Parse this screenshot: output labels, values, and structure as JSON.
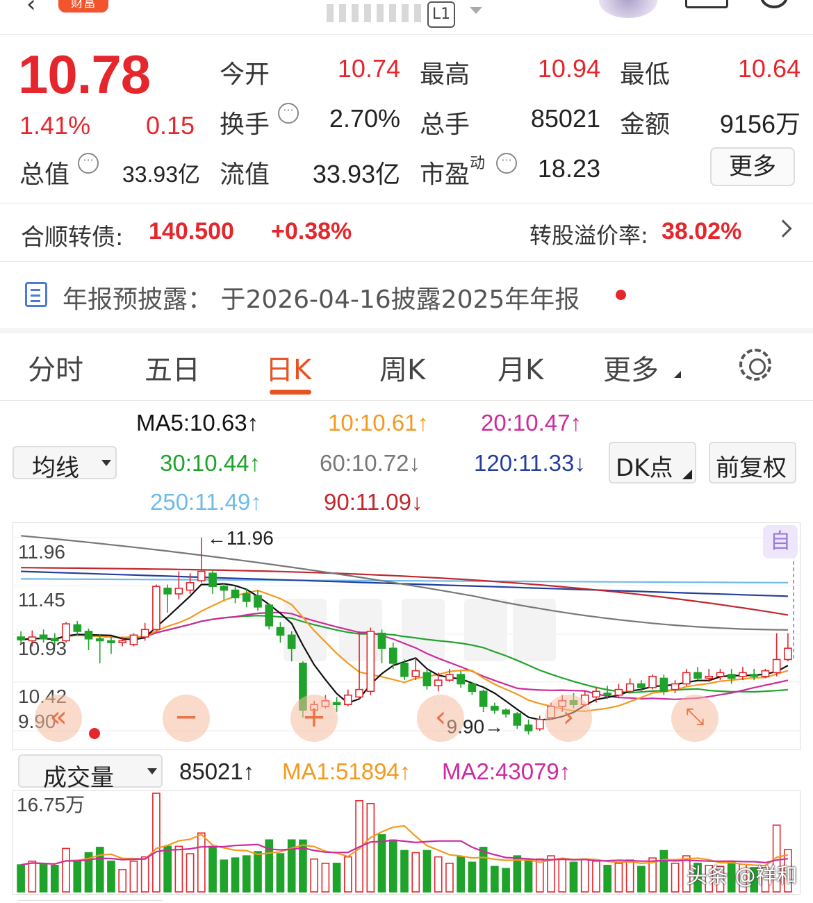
{
  "header": {
    "tag": "财富",
    "level": "L1"
  },
  "quote": {
    "price": "10.78",
    "change_pct": "1.41%",
    "change": "0.15",
    "open_label": "今开",
    "open": "10.74",
    "high_label": "最高",
    "high": "10.94",
    "low_label": "最低",
    "low": "10.64",
    "turnover_label": "换手",
    "turnover": "2.70%",
    "volume_label": "总手",
    "volume": "85021",
    "amount_label": "金额",
    "amount": "9156万",
    "mktcap_label": "总值",
    "mktcap": "33.93亿",
    "float_label": "流值",
    "float_cap": "33.93亿",
    "pe_label": "市盈",
    "pe_sup": "动",
    "pe": "18.23",
    "more_label": "更多"
  },
  "bond": {
    "label": "合顺转债:",
    "price": "140.500",
    "change_pct": "+0.38%",
    "premium_label": "转股溢价率:",
    "premium": "38.02%"
  },
  "notice": {
    "text": "年报预披露：  于2026-04-16披露2025年年报"
  },
  "tabs": [
    {
      "label": "分时",
      "active": false
    },
    {
      "label": "五日",
      "active": false
    },
    {
      "label": "日K",
      "active": true
    },
    {
      "label": "周K",
      "active": false
    },
    {
      "label": "月K",
      "active": false
    },
    {
      "label": "更多",
      "active": false
    }
  ],
  "ma_legend": {
    "selector": "均线",
    "ma5": "MA5:10.63",
    "ma10": "10:10.61",
    "ma20": "20:10.47",
    "ma30": "30:10.44",
    "ma60": "60:10.72",
    "ma120": "120:11.33",
    "ma250": "250:11.49",
    "ma90": "90:11.09",
    "arrow_up": "↑",
    "arrow_down": "↓",
    "dk_label": "DK点",
    "adjust_label": "前复权"
  },
  "chart_data": [
    {
      "type": "candlestick",
      "title": "",
      "y_ticks": [
        "11.96",
        "11.45",
        "10.93",
        "10.42",
        "9.90"
      ],
      "ylim": [
        9.9,
        11.96
      ],
      "max_marker": "11.96",
      "min_marker": "9.90",
      "series": [
        {
          "name": "MA5",
          "color": "#111111"
        },
        {
          "name": "10",
          "color": "#f39a1e"
        },
        {
          "name": "20",
          "color": "#cc2a9e"
        },
        {
          "name": "30",
          "color": "#1fa32a"
        },
        {
          "name": "60",
          "color": "#777777"
        },
        {
          "name": "90",
          "color": "#c1272d"
        },
        {
          "name": "120",
          "color": "#233e9c"
        },
        {
          "name": "250",
          "color": "#6fbbe8"
        }
      ],
      "candles": [
        [
          10.9,
          10.87,
          10.96,
          10.82
        ],
        [
          10.86,
          10.9,
          10.97,
          10.8
        ],
        [
          10.92,
          10.88,
          10.98,
          10.84
        ],
        [
          10.88,
          10.86,
          10.94,
          10.8
        ],
        [
          10.86,
          11.04,
          11.06,
          10.84
        ],
        [
          11.03,
          10.96,
          11.07,
          10.92
        ],
        [
          10.96,
          10.88,
          10.99,
          10.76
        ],
        [
          10.88,
          10.86,
          10.93,
          10.62
        ],
        [
          10.86,
          10.84,
          10.9,
          10.72
        ],
        [
          10.84,
          10.86,
          10.9,
          10.8
        ],
        [
          10.82,
          10.92,
          10.94,
          10.8
        ],
        [
          10.9,
          10.98,
          11.05,
          10.86
        ],
        [
          10.98,
          11.44,
          11.46,
          10.96
        ],
        [
          11.42,
          11.36,
          11.46,
          11.16
        ],
        [
          11.36,
          11.42,
          11.6,
          11.3
        ],
        [
          11.4,
          11.48,
          11.58,
          11.36
        ],
        [
          11.5,
          11.6,
          11.96,
          11.48
        ],
        [
          11.58,
          11.44,
          11.62,
          11.36
        ],
        [
          11.44,
          11.4,
          11.48,
          11.3
        ],
        [
          11.4,
          11.32,
          11.44,
          11.26
        ],
        [
          11.36,
          11.28,
          11.42,
          11.22
        ],
        [
          11.34,
          11.22,
          11.4,
          11.18
        ],
        [
          11.24,
          11.02,
          11.26,
          10.98
        ],
        [
          11.0,
          10.92,
          11.06,
          10.84
        ],
        [
          10.92,
          10.78,
          10.96,
          10.64
        ],
        [
          10.62,
          10.12,
          10.64,
          10.04
        ],
        [
          10.12,
          10.18,
          10.22,
          10.04
        ],
        [
          10.16,
          10.22,
          10.28,
          10.14
        ],
        [
          10.2,
          10.18,
          10.26,
          10.1
        ],
        [
          10.18,
          10.28,
          10.34,
          10.16
        ],
        [
          10.26,
          10.34,
          10.96,
          10.24
        ],
        [
          10.32,
          10.96,
          11.0,
          10.28
        ],
        [
          10.94,
          10.78,
          10.98,
          10.62
        ],
        [
          10.78,
          10.62,
          10.84,
          10.56
        ],
        [
          10.62,
          10.48,
          10.66,
          10.44
        ],
        [
          10.48,
          10.54,
          10.68,
          10.44
        ],
        [
          10.52,
          10.38,
          10.56,
          10.34
        ],
        [
          10.38,
          10.44,
          10.52,
          10.32
        ],
        [
          10.44,
          10.5,
          10.56,
          10.42
        ],
        [
          10.5,
          10.4,
          10.54,
          10.36
        ],
        [
          10.4,
          10.32,
          10.42,
          10.28
        ],
        [
          10.32,
          10.16,
          10.34,
          10.1
        ],
        [
          10.16,
          10.12,
          10.2,
          10.08
        ],
        [
          10.12,
          10.08,
          10.14,
          10.04
        ],
        [
          10.08,
          9.96,
          10.1,
          9.92
        ],
        [
          9.96,
          9.9,
          10.02,
          9.86
        ],
        [
          9.92,
          10.02,
          10.06,
          9.9
        ],
        [
          10.04,
          10.16,
          10.2,
          10.02
        ],
        [
          10.16,
          10.22,
          10.28,
          10.1
        ],
        [
          10.22,
          10.18,
          10.3,
          10.14
        ],
        [
          10.18,
          10.28,
          10.32,
          10.16
        ],
        [
          10.26,
          10.32,
          10.36,
          10.2
        ],
        [
          10.3,
          10.28,
          10.38,
          10.24
        ],
        [
          10.28,
          10.34,
          10.4,
          10.26
        ],
        [
          10.32,
          10.4,
          10.46,
          10.3
        ],
        [
          10.4,
          10.36,
          10.44,
          10.32
        ],
        [
          10.36,
          10.48,
          10.5,
          10.34
        ],
        [
          10.46,
          10.32,
          10.5,
          10.28
        ],
        [
          10.34,
          10.4,
          10.44,
          10.3
        ],
        [
          10.4,
          10.52,
          10.56,
          10.38
        ],
        [
          10.52,
          10.46,
          10.58,
          10.44
        ],
        [
          10.46,
          10.48,
          10.56,
          10.42
        ],
        [
          10.48,
          10.52,
          10.56,
          10.44
        ],
        [
          10.5,
          10.46,
          10.56,
          10.4
        ],
        [
          10.48,
          10.52,
          10.58,
          10.44
        ],
        [
          10.5,
          10.48,
          10.56,
          10.44
        ],
        [
          10.48,
          10.54,
          10.56,
          10.46
        ],
        [
          10.52,
          10.66,
          10.94,
          10.48
        ],
        [
          10.66,
          10.78,
          10.94,
          10.64
        ]
      ]
    },
    {
      "type": "bar",
      "title": "",
      "selector": "成交量",
      "volume": "85021",
      "ma1": "MA1:51894",
      "ma2": "MA2:43079",
      "y_ticks": [
        "16.75万"
      ],
      "ylim": [
        0,
        167500
      ],
      "series": [
        {
          "name": "MA1",
          "color": "#f39a1e"
        },
        {
          "name": "MA2",
          "color": "#cc2a9e"
        }
      ]
    }
  ],
  "watermark": "头条 @祥和"
}
